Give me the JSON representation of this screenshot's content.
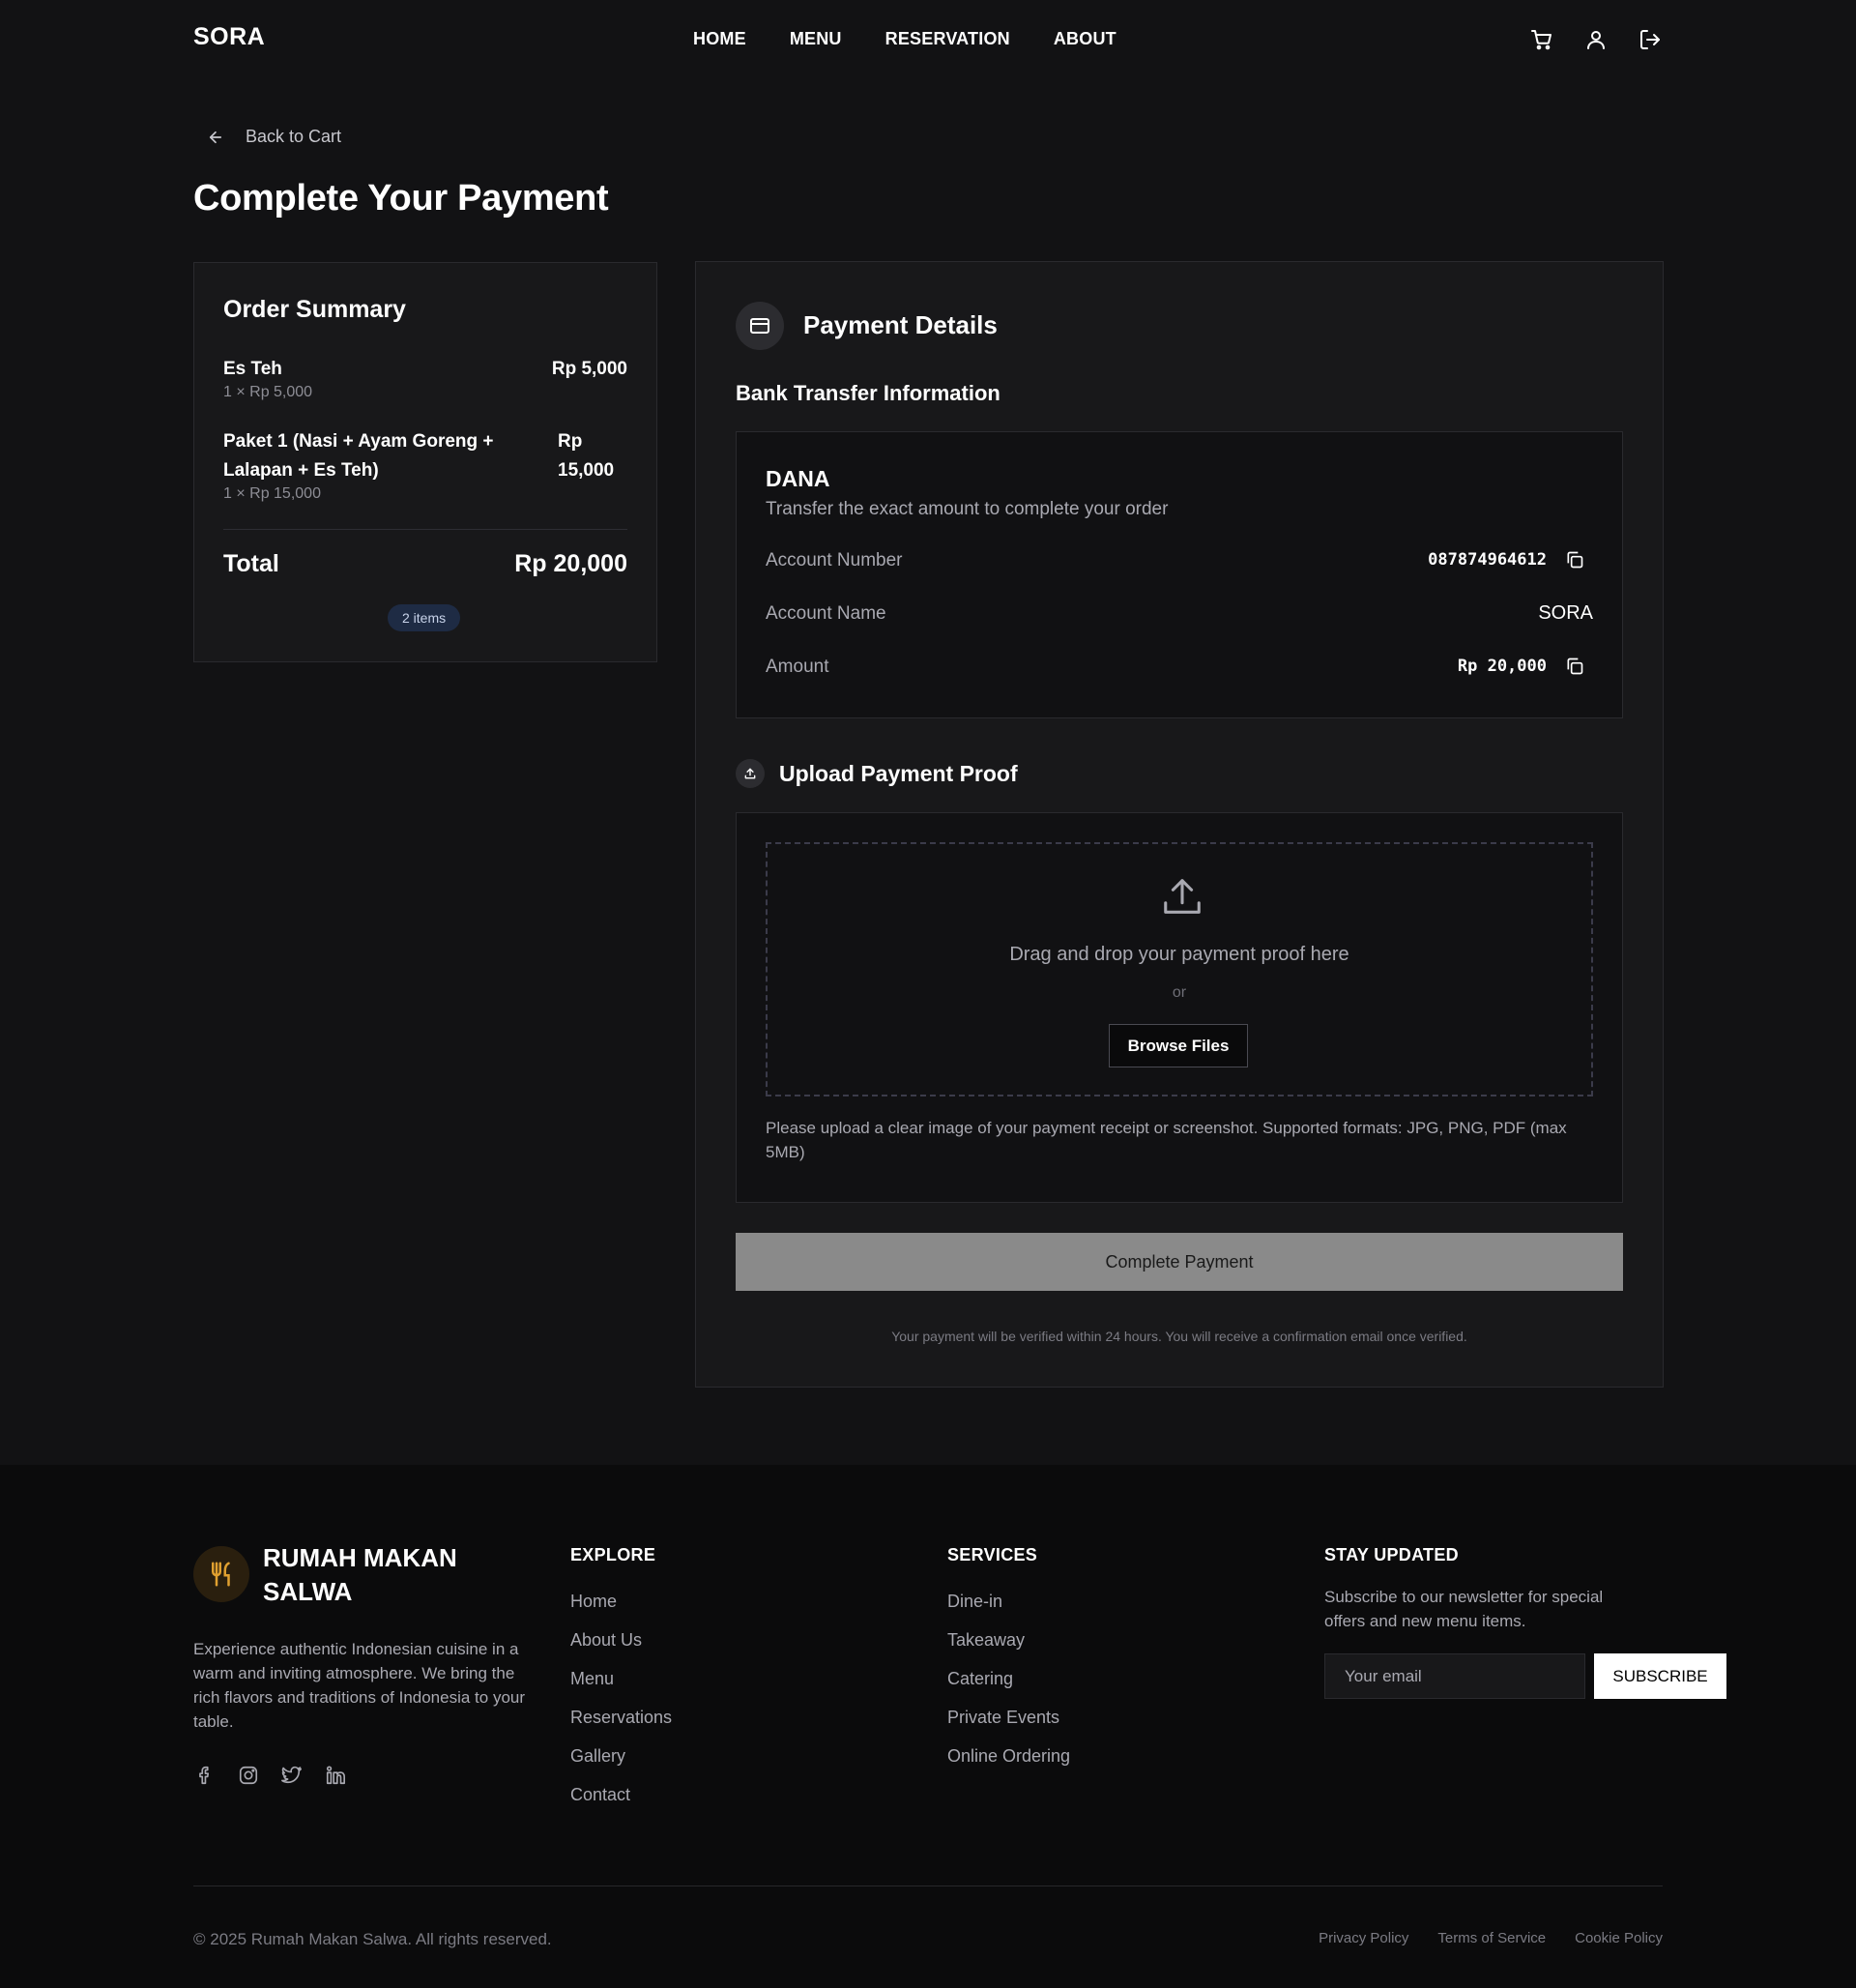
{
  "header": {
    "logo": "SORA",
    "nav": [
      "HOME",
      "MENU",
      "RESERVATION",
      "ABOUT"
    ],
    "icons": [
      "cart-icon",
      "user-icon",
      "logout-icon"
    ]
  },
  "back_link": "Back to Cart",
  "page_title": "Complete Your Payment",
  "order_summary": {
    "title": "Order Summary",
    "items": [
      {
        "name": "Es Teh",
        "detail": "1 × Rp 5,000",
        "price": "Rp 5,000"
      },
      {
        "name": "Paket 1 (Nasi + Ayam Goreng + Lalapan + Es Teh)",
        "detail": "1 × Rp 15,000",
        "price": "Rp 15,000"
      }
    ],
    "total_label": "Total",
    "total_value": "Rp 20,000",
    "items_badge": "2 items"
  },
  "payment": {
    "title": "Payment Details",
    "bank_section_title": "Bank Transfer Information",
    "bank_name": "DANA",
    "bank_description": "Transfer the exact amount to complete your order",
    "rows": {
      "account_number": {
        "label": "Account Number",
        "value": "087874964612"
      },
      "account_name": {
        "label": "Account Name",
        "value": "SORA"
      },
      "amount": {
        "label": "Amount",
        "value": "Rp 20,000"
      }
    },
    "upload_title": "Upload Payment Proof",
    "drop_text": "Drag and drop your payment proof here",
    "or_text": "or",
    "browse_label": "Browse Files",
    "upload_note": "Please upload a clear image of your payment receipt or screenshot. Supported formats: JPG, PNG, PDF (max 5MB)",
    "complete_label": "Complete Payment",
    "verify_note": "Your payment will be verified within 24 hours. You will receive a confirmation email once verified."
  },
  "footer": {
    "brand": "RUMAH MAKAN SALWA",
    "description": "Experience authentic Indonesian cuisine in a warm and inviting atmosphere. We bring the rich flavors and traditions of Indonesia to your table.",
    "socials": [
      "facebook-icon",
      "instagram-icon",
      "twitter-icon",
      "linkedin-icon"
    ],
    "explore": {
      "title": "EXPLORE",
      "links": [
        "Home",
        "About Us",
        "Menu",
        "Reservations",
        "Gallery",
        "Contact"
      ]
    },
    "services": {
      "title": "SERVICES",
      "links": [
        "Dine-in",
        "Takeaway",
        "Catering",
        "Private Events",
        "Online Ordering"
      ]
    },
    "newsletter": {
      "title": "STAY UPDATED",
      "description": "Subscribe to our newsletter for special offers and new menu items.",
      "placeholder": "Your email",
      "button": "SUBSCRIBE"
    },
    "copyright": "© 2025 Rumah Makan Salwa. All rights reserved.",
    "legal": [
      "Privacy Policy",
      "Terms of Service",
      "Cookie Policy"
    ]
  },
  "colors": {
    "background": "#121214",
    "card": "#18181a",
    "footer": "#0b0b0c",
    "badge": "#1e2b44",
    "complete_button": "#8a8a8a",
    "logo_accent": "#e0a030"
  }
}
